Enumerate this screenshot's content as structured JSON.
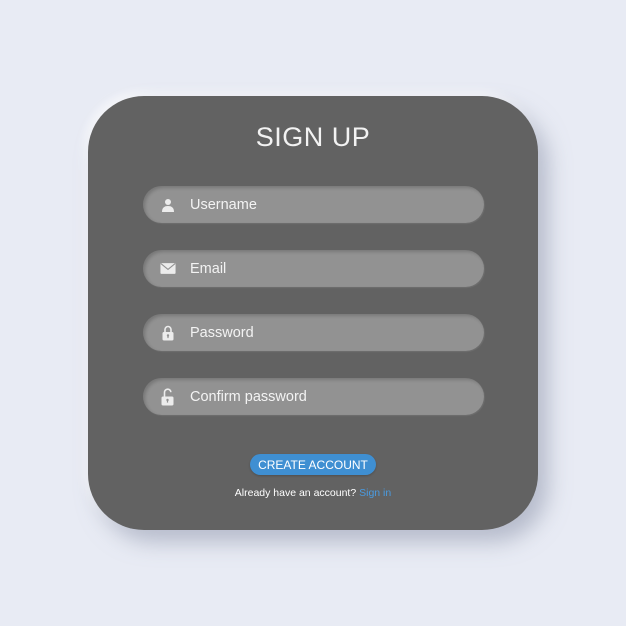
{
  "form": {
    "title": "SIGN UP",
    "fields": [
      {
        "placeholder": "Username",
        "icon": "user-icon"
      },
      {
        "placeholder": "Email",
        "icon": "envelope-icon"
      },
      {
        "placeholder": "Password",
        "icon": "lock-icon"
      },
      {
        "placeholder": "Confirm password",
        "icon": "unlock-icon"
      }
    ],
    "submit_label": "CREATE ACCOUNT",
    "footer_text": "Already have an account?",
    "signin_link": "Sign in"
  },
  "colors": {
    "background": "#e8ebf4",
    "card": "#626262",
    "field": "#929292",
    "accent": "#3f8fd2",
    "link": "#4a9be0"
  }
}
